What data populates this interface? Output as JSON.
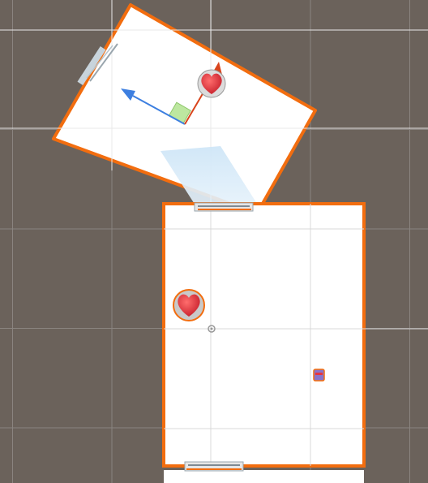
{
  "view": "scene-view",
  "colors": {
    "background": "#6b625b",
    "grid": "#7d756f",
    "grid_major": "#8a8480",
    "selection_outline": "#f26d0f",
    "room_fill": "#ffffff",
    "camera_frustum": "#cfe6f7",
    "axis_x": "#d9441c",
    "axis_y": "#3d7fe0",
    "axis_plane": "#bde7a0",
    "pickup_red": "#e8343f"
  },
  "objects": [
    {
      "name": "room-rotated",
      "type": "sprite-room",
      "selected": true
    },
    {
      "name": "room-main",
      "type": "sprite-room",
      "selected": true
    },
    {
      "name": "heart-pickup-top",
      "type": "pickup",
      "icon": "heart-icon"
    },
    {
      "name": "heart-pickup-left",
      "type": "pickup",
      "icon": "heart-icon"
    },
    {
      "name": "small-item",
      "type": "pickup",
      "icon": "gem-icon"
    },
    {
      "name": "door-top",
      "type": "doorway",
      "icon": "door-icon"
    },
    {
      "name": "door-bottom",
      "type": "doorway",
      "icon": "door-icon"
    },
    {
      "name": "door-side",
      "type": "doorway",
      "icon": "door-icon"
    },
    {
      "name": "pivot",
      "type": "gizmo",
      "icon": "pivot-icon"
    },
    {
      "name": "move-gizmo",
      "type": "gizmo",
      "icon": "move-tool-icon"
    }
  ]
}
